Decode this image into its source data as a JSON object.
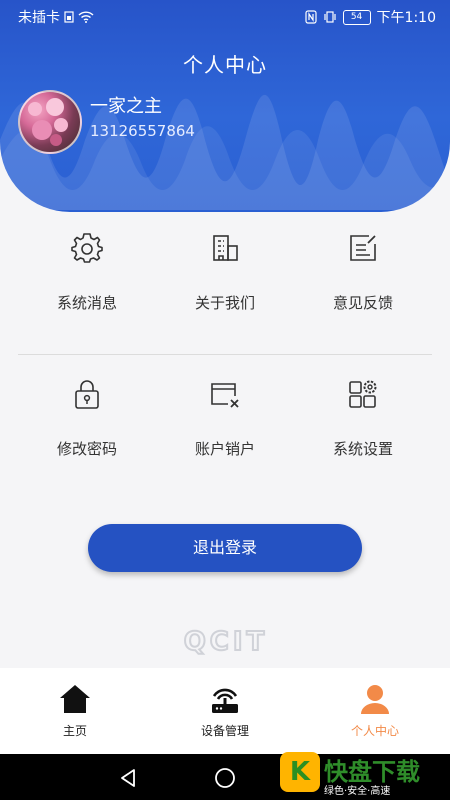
{
  "status_bar": {
    "carrier": "未插卡",
    "battery": "54",
    "time": "下午1:10"
  },
  "header": {
    "title": "个人中心",
    "username": "一家之主",
    "phone": "13126557864"
  },
  "menu": {
    "row1": [
      {
        "label": "系统消息",
        "icon": "gear-icon"
      },
      {
        "label": "关于我们",
        "icon": "building-icon"
      },
      {
        "label": "意见反馈",
        "icon": "edit-icon"
      }
    ],
    "row2": [
      {
        "label": "修改密码",
        "icon": "lock-icon"
      },
      {
        "label": "账户销户",
        "icon": "card-remove-icon"
      },
      {
        "label": "系统设置",
        "icon": "settings-grid-icon"
      }
    ]
  },
  "logout_label": "退出登录",
  "brand_logo_text": "QCIT",
  "tabbar": {
    "items": [
      {
        "label": "主页",
        "icon": "home-icon"
      },
      {
        "label": "设备管理",
        "icon": "router-icon"
      },
      {
        "label": "个人中心",
        "icon": "user-icon"
      }
    ],
    "active_color": "#f28a48"
  },
  "watermark": {
    "badge": "K",
    "title": "快盘下载",
    "subtitle": "绿色·安全·高速"
  },
  "colors": {
    "primary": "#2552c2",
    "accent": "#f28a48"
  }
}
